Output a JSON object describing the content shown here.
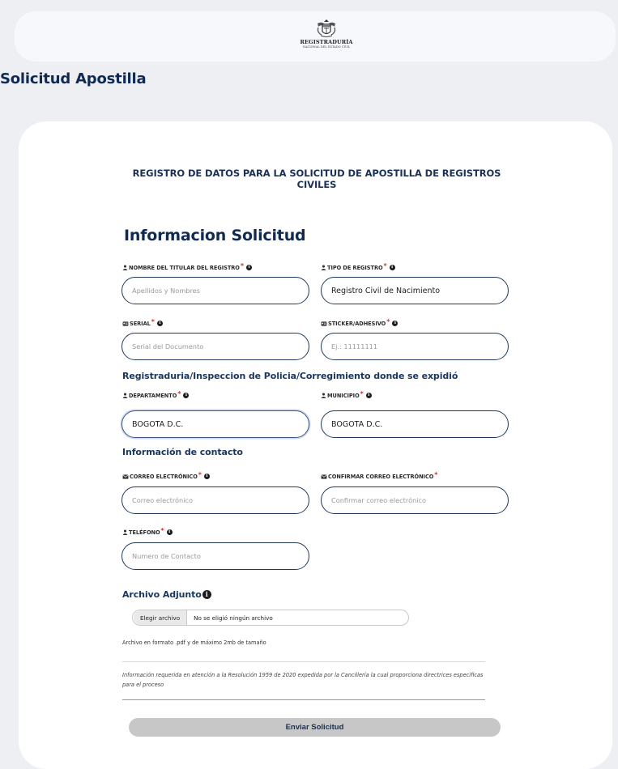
{
  "header": {
    "logo_title": "REGISTRADURÍA",
    "logo_subtitle": "NACIONAL DEL ESTADO CIVIL"
  },
  "page_title": "Solicitud Apostilla",
  "form": {
    "heading": "REGISTRO DE DATOS PARA LA SOLICITUD DE APOSTILLA DE REGISTROS CIVILES",
    "section_title": "Informacion Solicitud",
    "fields": {
      "nombre": {
        "label": "NOMBRE DEL TITULAR DEL REGISTRO",
        "placeholder": "Apellidos y Nombres",
        "value": ""
      },
      "tipo": {
        "label": "TIPO DE REGISTRO",
        "value": "Registro Civil de Nacimiento"
      },
      "serial": {
        "label": "SERIAL",
        "placeholder": "Serial del Documento",
        "value": ""
      },
      "sticker": {
        "label": "STICKER/ADHESIVO",
        "placeholder": "Ej.: 11111111",
        "value": ""
      },
      "departamento": {
        "label": "DEPARTAMENTO",
        "value": "BOGOTA D.C."
      },
      "municipio": {
        "label": "MUNICIPIO",
        "value": "BOGOTA D.C."
      },
      "correo": {
        "label": "CORREO ELECTRÓNICO",
        "placeholder": "Correo electrónico",
        "value": ""
      },
      "confirmar": {
        "label": "CONFIRMAR CORREO ELECTRÓNICO",
        "placeholder": "Confirmar correo electrónico",
        "value": ""
      },
      "telefono": {
        "label": "TELÉFONO",
        "placeholder": "Numero de Contacto",
        "value": ""
      }
    },
    "subsection_location": "Registraduria/Inspeccion de Policia/Corregimiento donde se expidió",
    "subsection_contact": "Información de contacto",
    "attachment": {
      "title": "Archivo Adjunto",
      "button_label": "Elegir archivo",
      "status": "No se eligió ningún archivo",
      "hint": "Archivo en formato .pdf y de máximo 2mb de tamaño"
    },
    "note": "Información requerida en atención a la Resolución 1959 de 2020 expedida por la Cancillería la cual proporciona directrices especificas para el proceso",
    "submit_label": "Enviar Solicitud"
  }
}
